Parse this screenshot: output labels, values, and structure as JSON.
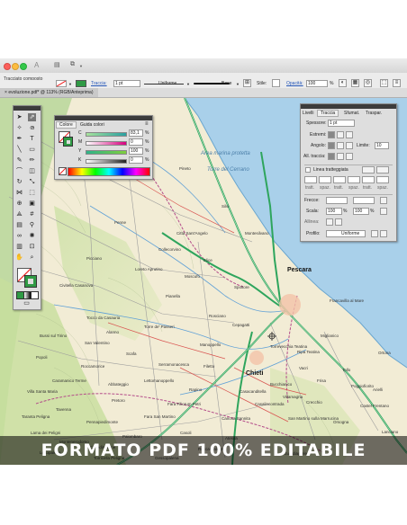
{
  "window": {
    "app_controls": [
      "A",
      "▤",
      "⧉"
    ],
    "title_label": "Tracciato composto"
  },
  "options_bar": {
    "stroke_label": "Traccia:",
    "stroke_weight": "1 pt",
    "profile_value": "Uniforme",
    "brush_value": "Base",
    "style_label": "Stile:",
    "opacity_label": "Opacità:",
    "opacity_value": "100",
    "opacity_unit": "%"
  },
  "document_tab": {
    "title": "evoluzione.pdf* @ 113% (RGB/Anteprima)",
    "close": "×"
  },
  "map": {
    "sea_labels": [
      "Area marina protetta",
      "Torre del Cerrano"
    ],
    "cities": [
      "Pescara",
      "Chieti"
    ],
    "towns": [
      "Pineto",
      "Silvi",
      "Città Sant'Angelo",
      "Montesilvano",
      "Spoltore",
      "Francavilla al Mare",
      "Cepagatti",
      "Rosciano",
      "Manoppello",
      "Torrevecchia Teatina",
      "Ripa Teatina",
      "Bucchianico",
      "Casalincontrada",
      "Guardiagrele",
      "Lanciano",
      "Orsogna",
      "Ortona",
      "Miglianico",
      "Tollo",
      "Loreto Aprutino",
      "Penne",
      "Pianella",
      "Moscufo",
      "Collecorvino",
      "Elice",
      "Picciano",
      "Civitella Casanova",
      "Caramanico Terme",
      "San Valentino",
      "Popoli",
      "Bussi sul Tirino",
      "Alanno",
      "Scafa",
      "Tocco da Casauria",
      "Torre de' Passeri",
      "Serramonacesca",
      "Roccamorice",
      "Lettomanoppello",
      "Abbateggio",
      "Pretoro",
      "Fara Filiorum Petri",
      "Rapino",
      "Pennapiedimonte",
      "Palombaro",
      "Casoli",
      "Atessa",
      "Villa Santa Maria",
      "Castel Frentano",
      "Crecchio",
      "Frisa",
      "Poggiofiorito",
      "Arielli",
      "Canosa Sannita",
      "Filetto",
      "Vacri",
      "San Martino sulla Marrucina",
      "Villamagna",
      "Casacanditella",
      "Tavenna",
      "Montenerodomo",
      "Lama dei Peligni",
      "Taranta Peligna",
      "Fara San Martino",
      "Lettopalena",
      "Colledimacine",
      "Torricella Peligna",
      "Gessopalena",
      "Roccascalegna"
    ]
  },
  "color_panel": {
    "tab_active": "Colore",
    "tab_other": "Guida colori",
    "channels": [
      {
        "label": "C",
        "value": "83,1",
        "unit": "%",
        "color": "#00a0d6"
      },
      {
        "label": "M",
        "value": "0",
        "unit": "%",
        "color": "#d6007e"
      },
      {
        "label": "Y",
        "value": "100",
        "unit": "%",
        "color": "#e9d600"
      },
      {
        "label": "K",
        "value": "0",
        "unit": "%",
        "color": "#222222"
      }
    ],
    "fill_color": "#2f9a45"
  },
  "stroke_panel": {
    "tabs": [
      "Livelli",
      "Traccia",
      "Sfumat.",
      "Traspar."
    ],
    "weight_label": "Spessore:",
    "weight_value": "1 pt",
    "caps_label": "Estremi:",
    "corner_label": "Angolo:",
    "limit_label": "Limite:",
    "limit_value": "10",
    "align_label": "All. traccia:",
    "dashed_label": "Linea tratteggiata",
    "dash_labels": [
      "tratt.",
      "spaz.",
      "tratt.",
      "spaz.",
      "tratt.",
      "spaz."
    ],
    "arrow_label": "Frecce:",
    "scale_label": "Scala:",
    "scale_value_1": "100",
    "scale_value_2": "100",
    "scale_unit": "%",
    "align_arrow_label": "Allinea:",
    "profile_label": "Profilo:",
    "profile_value": "Uniforme"
  },
  "banner": {
    "text": "FORMATO PDF 100% EDITABILE"
  },
  "colors": {
    "sea": "#a9d0ea",
    "land": "#f2ecd5",
    "green_terrain": "#b8d79a",
    "road": "#2ea55d",
    "border": "#b44c8a",
    "panel_bg": "#dedede"
  }
}
